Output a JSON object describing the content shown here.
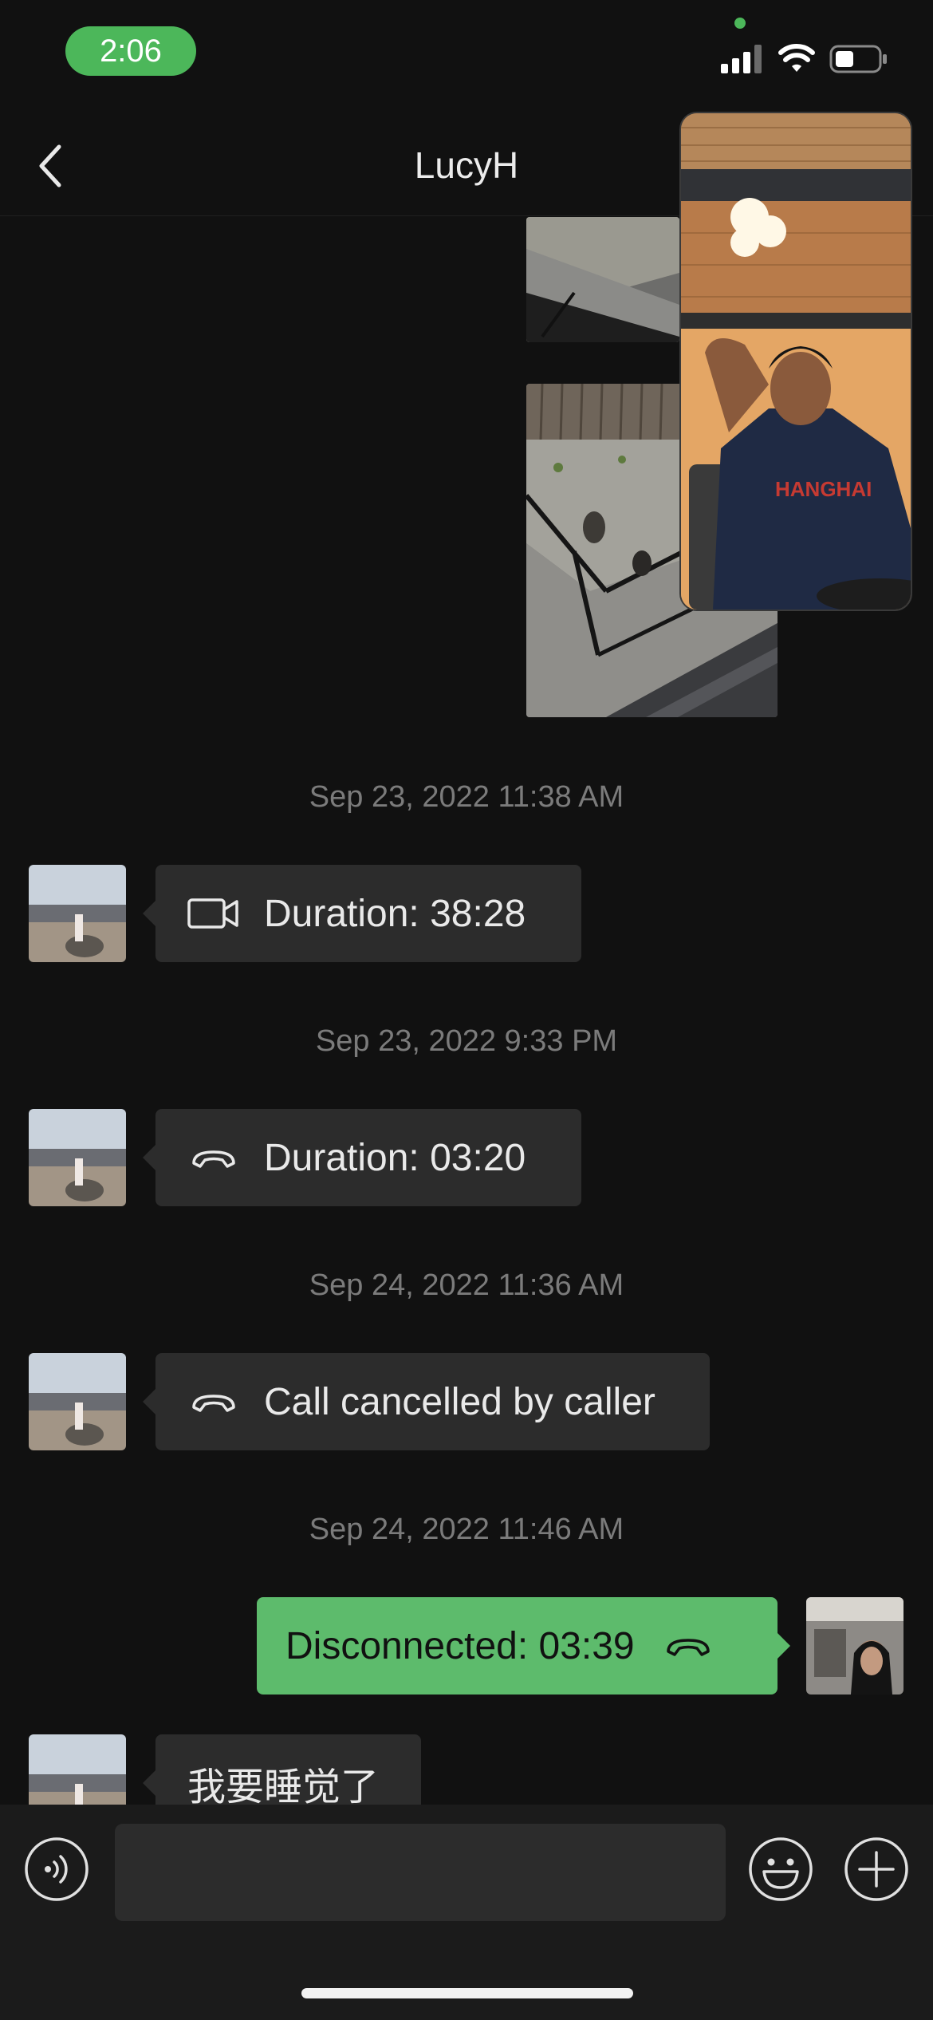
{
  "status_bar": {
    "time": "2:06"
  },
  "nav": {
    "title": "LucyH"
  },
  "messages": [
    {
      "timestamp": "Sep 23, 2022 11:38 AM",
      "icon": "video-camera-icon",
      "text": "Duration: 38:28",
      "direction": "incoming"
    },
    {
      "timestamp": "Sep 23, 2022 9:33 PM",
      "icon": "phone-icon",
      "text": "Duration: 03:20",
      "direction": "incoming"
    },
    {
      "timestamp": "Sep 24, 2022 11:36 AM",
      "icon": "phone-icon",
      "text": "Call cancelled by caller",
      "direction": "incoming"
    },
    {
      "timestamp": "Sep 24, 2022 11:46 AM",
      "icon": "phone-icon",
      "text": "Disconnected: 03:39",
      "direction": "outgoing"
    },
    {
      "timestamp": "",
      "icon": "",
      "text": "我要睡觉了",
      "direction": "incoming"
    }
  ],
  "input": {
    "value": "",
    "placeholder": ""
  },
  "colors": {
    "accent": "#5dbb6c",
    "background": "#111111",
    "bubble": "#2c2c2c"
  }
}
